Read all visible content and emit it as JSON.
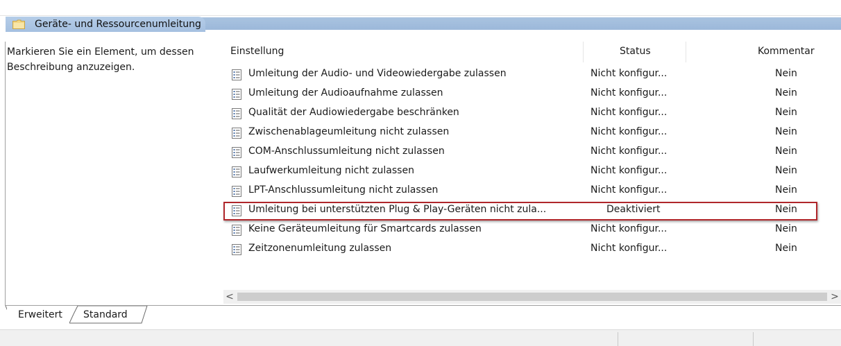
{
  "header": {
    "title": "Geräte- und Ressourcenumleitung",
    "icon": "folder-icon"
  },
  "left_pane": {
    "description": "Markieren Sie ein Element, um dessen Beschreibung anzuzeigen."
  },
  "list": {
    "columns": {
      "setting": "Einstellung",
      "status": "Status",
      "comment": "Kommentar"
    },
    "rows": [
      {
        "name": "Umleitung der Audio- und Videowiedergabe zulassen",
        "status": "Nicht konfigur...",
        "comment": "Nein"
      },
      {
        "name": "Umleitung der Audioaufnahme zulassen",
        "status": "Nicht konfigur...",
        "comment": "Nein"
      },
      {
        "name": "Qualität der Audiowiedergabe beschränken",
        "status": "Nicht konfigur...",
        "comment": "Nein"
      },
      {
        "name": "Zwischenablageumleitung nicht zulassen",
        "status": "Nicht konfigur...",
        "comment": "Nein"
      },
      {
        "name": "COM-Anschlussumleitung nicht zulassen",
        "status": "Nicht konfigur...",
        "comment": "Nein"
      },
      {
        "name": "Laufwerkumleitung nicht zulassen",
        "status": "Nicht konfigur...",
        "comment": "Nein"
      },
      {
        "name": "LPT-Anschlussumleitung nicht zulassen",
        "status": "Nicht konfigur...",
        "comment": "Nein"
      },
      {
        "name": "Umleitung bei unterstützten Plug & Play-Geräten nicht zula...",
        "status": "Deaktiviert",
        "comment": "Nein"
      },
      {
        "name": "Keine Geräteumleitung für Smartcards zulassen",
        "status": "Nicht konfigur...",
        "comment": "Nein"
      },
      {
        "name": "Zeitzonenumleitung zulassen",
        "status": "Nicht konfigur...",
        "comment": "Nein"
      }
    ],
    "highlight_color": "#b0262b"
  },
  "scrollbar": {
    "left_arrow": "<",
    "right_arrow": ">"
  },
  "tabs": {
    "extended": "Erweitert",
    "standard": "Standard"
  },
  "colors": {
    "header_band": "#a5c0e0",
    "status_bar": "#f0f0f0"
  }
}
